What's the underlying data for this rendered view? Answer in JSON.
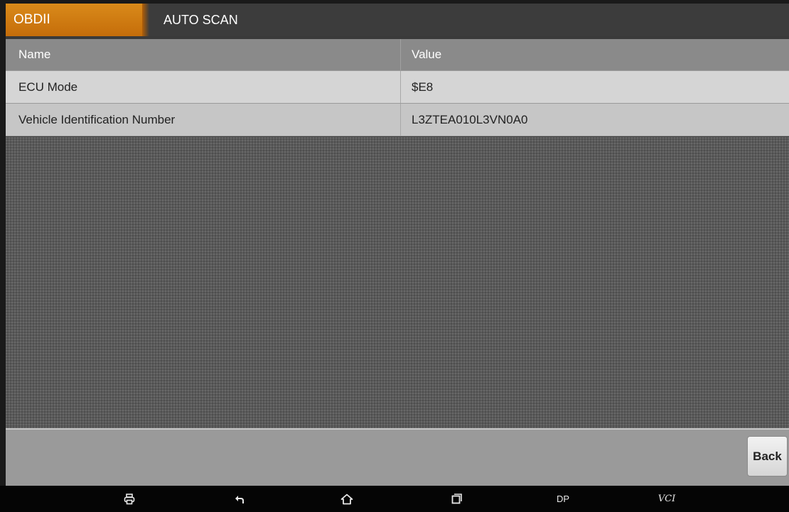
{
  "header": {
    "tab_label": "OBDII",
    "title": "AUTO SCAN"
  },
  "table": {
    "columns": [
      "Name",
      "Value"
    ],
    "rows": [
      {
        "name": "ECU Mode",
        "value": "$E8"
      },
      {
        "name": "Vehicle Identification Number",
        "value": "L3ZTEA010L3VN0A0"
      }
    ]
  },
  "actions": {
    "back_label": "Back"
  },
  "navbar": {
    "items": [
      {
        "icon": "printer-icon"
      },
      {
        "icon": "back-arrow-icon"
      },
      {
        "icon": "home-icon"
      },
      {
        "icon": "recent-apps-icon"
      },
      {
        "label": "DP"
      },
      {
        "label": "VCI"
      }
    ]
  },
  "colors": {
    "accent": "#d2790f",
    "titlebar": "#3c3c3c",
    "table_header": "#8a8a8a",
    "actionbar": "#9a9a9a"
  }
}
